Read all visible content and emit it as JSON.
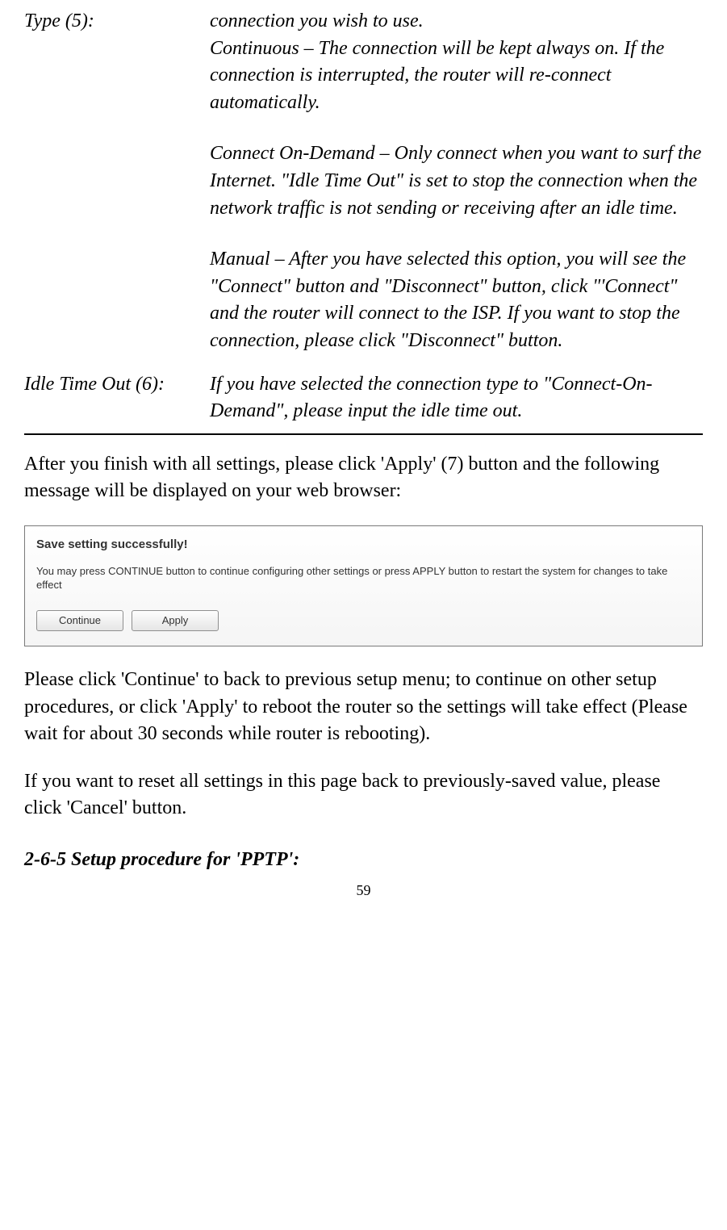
{
  "definitions": {
    "type": {
      "label": "Type (5):",
      "intro": "connection you wish to use.",
      "continuous": "Continuous – The connection will be kept always on. If the connection is interrupted, the router will re-connect automatically.",
      "on_demand": "Connect On-Demand – Only connect when you want to surf the Internet. \"Idle Time Out\" is set to stop the connection when the network traffic is not sending or receiving after an idle time.",
      "manual": "Manual – After you have selected this option, you will see the \"Connect\" button and \"Disconnect\" button, click \"'Connect\" and the router will connect to the ISP. If you want to stop the connection, please click \"Disconnect\" button."
    },
    "idle": {
      "label": "Idle Time Out (6):",
      "content": "If you have selected the connection type to \"Connect-On-Demand\", please input the idle time out."
    }
  },
  "body": {
    "after_settings": "After you finish with all settings, please click 'Apply' (7) button and the following message will be displayed on your web browser:",
    "continue_text": "Please click 'Continue' to back to previous setup menu; to continue on other setup procedures, or click 'Apply' to reboot the router so the settings will take effect (Please wait for about 30 seconds while router is rebooting).",
    "reset_text": "If you want to reset all settings in this page back to previously-saved value, please click 'Cancel' button."
  },
  "dialog": {
    "title": "Save setting successfully!",
    "text": "You may press CONTINUE button to continue configuring other settings or press APPLY button to restart the system for changes to take effect",
    "continue_btn": "Continue",
    "apply_btn": "Apply"
  },
  "heading": "2-6-5 Setup procedure for 'PPTP':",
  "page_number": "59"
}
